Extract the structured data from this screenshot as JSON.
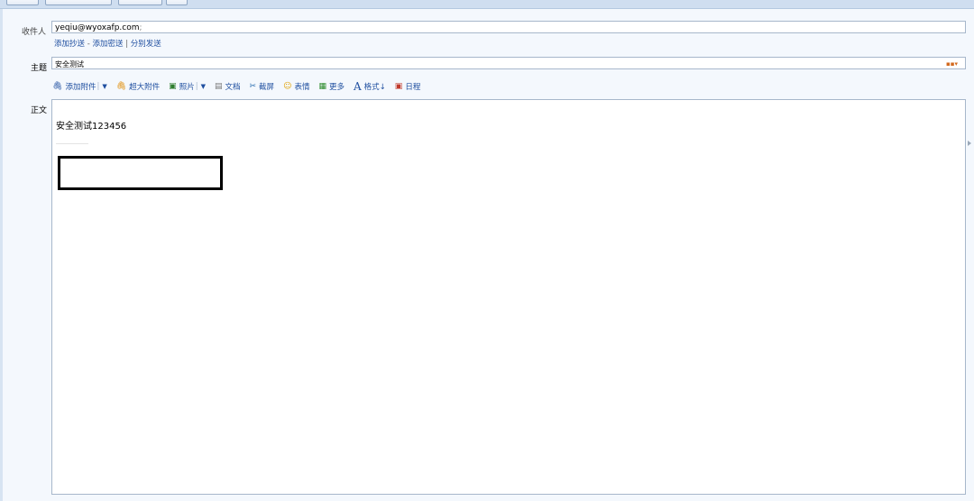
{
  "compose": {
    "to_label": "收件人",
    "to_value": "yeqiu@wyoxafp.com",
    "to_separator": ";",
    "recipient_links": {
      "add_cc": "添加抄送",
      "dash": "-",
      "add_bcc": "添加密送",
      "pipe": "|",
      "send_separately": "分别发送"
    },
    "subject_label": "主题",
    "subject_value": "安全测试",
    "subject_picker_icon": "grid-color-icon",
    "body_label": "正文",
    "body_text": "安全测试123456"
  },
  "toolbar": {
    "add_attachment": "添加附件",
    "large_attachment": "超大附件",
    "photo": "照片",
    "document": "文档",
    "screenshot": "截屏",
    "emoji": "表情",
    "more": "更多",
    "format": "格式↓",
    "schedule": "日程"
  },
  "colors": {
    "link": "#1f4fa0",
    "page_background": "#f4f8fd",
    "field_border": "#a7b7cb",
    "top_bar": "#cfdef0"
  }
}
